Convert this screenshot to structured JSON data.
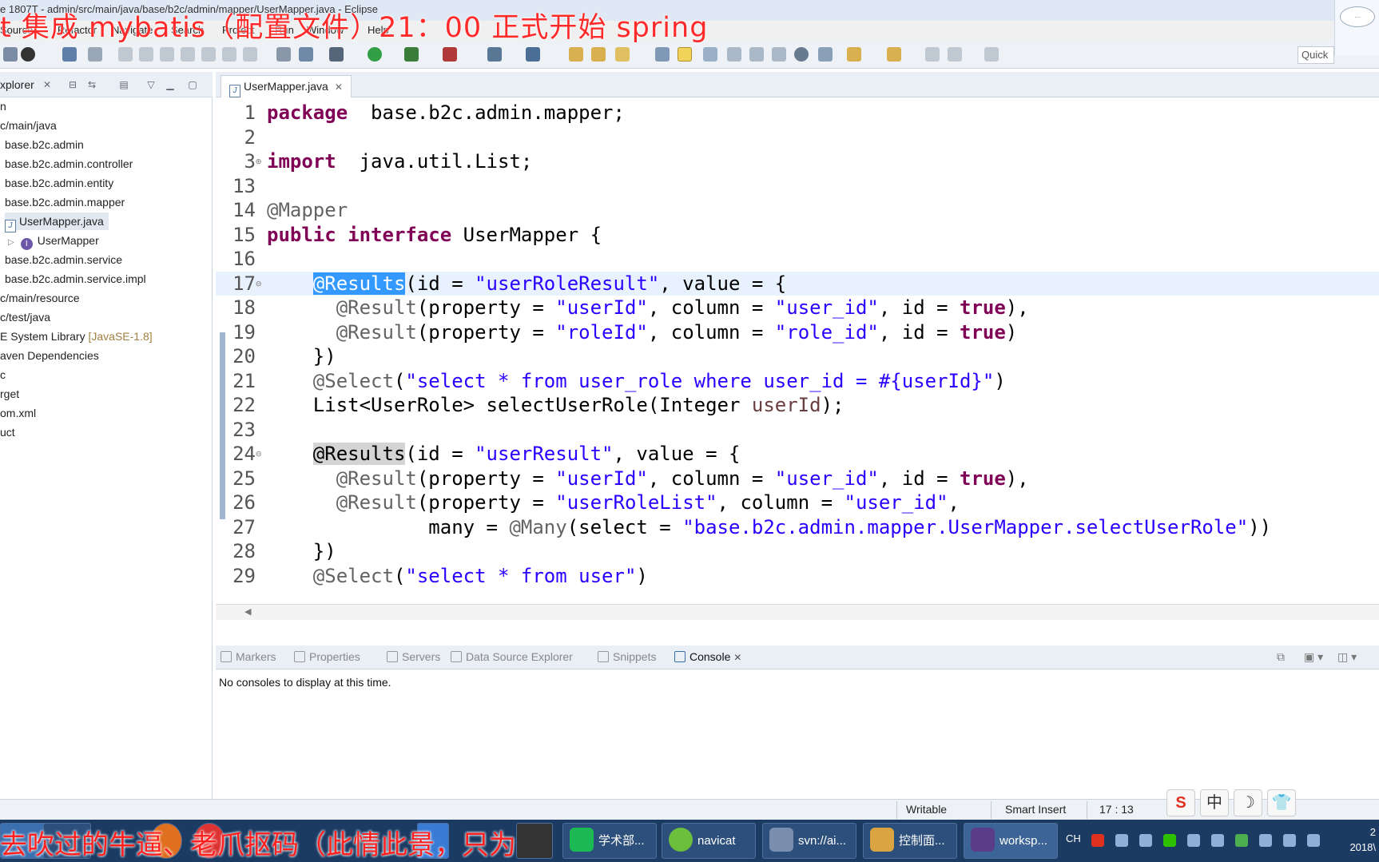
{
  "window": {
    "title_path": "e 1807T - admin/src/main/java/base/b2c/admin/mapper/UserMapper.java - Eclipse",
    "overlay_banner": "t 集成 mybatis（配置文件）21：00 正式开始  spring"
  },
  "menu": [
    "Source",
    "Refactor",
    "Navigate",
    "Search",
    "Project",
    "Run",
    "Window",
    "Help"
  ],
  "toolbar": {
    "quick_access": "Quick"
  },
  "explorer": {
    "title": "xplorer",
    "items": [
      {
        "label": "n"
      },
      {
        "label": "c/main/java"
      },
      {
        "label": "base.b2c.admin"
      },
      {
        "label": "base.b2c.admin.controller"
      },
      {
        "label": "base.b2c.admin.entity"
      },
      {
        "label": "base.b2c.admin.mapper"
      },
      {
        "label": "UserMapper.java"
      },
      {
        "label": "UserMapper"
      },
      {
        "label": "base.b2c.admin.service"
      },
      {
        "label": "base.b2c.admin.service.impl"
      },
      {
        "label": "c/main/resource"
      },
      {
        "label": "c/test/java"
      },
      {
        "label": "E System Library",
        "decoration": "[JavaSE-1.8]"
      },
      {
        "label": "aven Dependencies"
      },
      {
        "label": "c"
      },
      {
        "label": "rget"
      },
      {
        "label": "om.xml"
      },
      {
        "label": "uct"
      }
    ]
  },
  "editor": {
    "tab_label": "UserMapper.java",
    "lines": [
      {
        "n": "1",
        "segs": [
          [
            "kw",
            "package"
          ],
          [
            "",
            "  base.b2c.admin.mapper;"
          ]
        ]
      },
      {
        "n": "2",
        "segs": []
      },
      {
        "n": "3",
        "fold": "⊕",
        "segs": [
          [
            "kw",
            "import"
          ],
          [
            "",
            "  java.util.List;"
          ]
        ]
      },
      {
        "n": "13",
        "segs": []
      },
      {
        "n": "14",
        "segs": [
          [
            "ann",
            "@Mapper"
          ]
        ]
      },
      {
        "n": "15",
        "segs": [
          [
            "kw",
            "public"
          ],
          [
            "",
            " "
          ],
          [
            "kw",
            "interface"
          ],
          [
            "",
            "",
            " "
          ],
          [
            "",
            "UserMapper {"
          ]
        ]
      },
      {
        "n": "16",
        "segs": []
      },
      {
        "n": "17",
        "fold": "⊖",
        "cur": true,
        "segs": [
          [
            "",
            "    "
          ],
          [
            "ann-sel",
            "@Results"
          ],
          [
            "",
            "(id = "
          ],
          [
            "str",
            "\"userRoleResult\""
          ],
          [
            "",
            ", value = {"
          ]
        ]
      },
      {
        "n": "18",
        "segs": [
          [
            "",
            "      "
          ],
          [
            "ann",
            "@Result"
          ],
          [
            "",
            "(property = "
          ],
          [
            "str",
            "\"userId\""
          ],
          [
            "",
            ", column = "
          ],
          [
            "str",
            "\"user_id\""
          ],
          [
            "",
            ", id = "
          ],
          [
            "kw",
            "true"
          ],
          [
            "",
            "),"
          ]
        ]
      },
      {
        "n": "19",
        "segs": [
          [
            "",
            "      "
          ],
          [
            "ann",
            "@Result"
          ],
          [
            "",
            "(property = "
          ],
          [
            "str",
            "\"roleId\""
          ],
          [
            "",
            ", column = "
          ],
          [
            "str",
            "\"role_id\""
          ],
          [
            "",
            ", id = "
          ],
          [
            "kw",
            "true"
          ],
          [
            "",
            ")"
          ]
        ]
      },
      {
        "n": "20",
        "segs": [
          [
            "",
            "    })"
          ]
        ]
      },
      {
        "n": "21",
        "segs": [
          [
            "",
            "    "
          ],
          [
            "ann",
            "@Select"
          ],
          [
            "",
            "("
          ],
          [
            "str",
            "\"select * from user_role where user_id = #{userId}\""
          ],
          [
            "",
            ")"
          ]
        ]
      },
      {
        "n": "22",
        "segs": [
          [
            "",
            "    List<UserRole> selectUserRole(Integer "
          ],
          [
            "var",
            "userId"
          ],
          [
            "",
            ");"
          ]
        ]
      },
      {
        "n": "23",
        "segs": []
      },
      {
        "n": "24",
        "fold": "⊖",
        "segs": [
          [
            "",
            "    "
          ],
          [
            "ann-hl",
            "@Results"
          ],
          [
            "",
            "(id = "
          ],
          [
            "str",
            "\"userResult\""
          ],
          [
            "",
            ", value = {"
          ]
        ]
      },
      {
        "n": "25",
        "segs": [
          [
            "",
            "      "
          ],
          [
            "ann",
            "@Result"
          ],
          [
            "",
            "(property = "
          ],
          [
            "str",
            "\"userId\""
          ],
          [
            "",
            ", column = "
          ],
          [
            "str",
            "\"user_id\""
          ],
          [
            "",
            ", id = "
          ],
          [
            "kw",
            "true"
          ],
          [
            "",
            "),"
          ]
        ]
      },
      {
        "n": "26",
        "segs": [
          [
            "",
            "      "
          ],
          [
            "ann",
            "@Result"
          ],
          [
            "",
            "(property = "
          ],
          [
            "str",
            "\"userRoleList\""
          ],
          [
            "",
            ", column = "
          ],
          [
            "str",
            "\"user_id\""
          ],
          [
            "",
            ","
          ]
        ]
      },
      {
        "n": "27",
        "segs": [
          [
            "",
            "              many = "
          ],
          [
            "ann",
            "@Many"
          ],
          [
            "",
            "(select = "
          ],
          [
            "str",
            "\"base.b2c.admin.mapper.UserMapper.selectUserRole\""
          ],
          [
            "",
            "))"
          ]
        ]
      },
      {
        "n": "28",
        "segs": [
          [
            "",
            "    })"
          ]
        ]
      },
      {
        "n": "29",
        "segs": [
          [
            "",
            "    "
          ],
          [
            "ann",
            "@Select"
          ],
          [
            "",
            "("
          ],
          [
            "str",
            "\"select * from user\""
          ],
          [
            "",
            ")"
          ]
        ]
      }
    ]
  },
  "console": {
    "tabs": [
      "Markers",
      "Properties",
      "Servers",
      "Data Source Explorer",
      "Snippets",
      "Console"
    ],
    "message": "No consoles to display at this time."
  },
  "status": {
    "writable": "Writable",
    "insert_mode": "Smart Insert",
    "position": "17 : 13"
  },
  "ime": [
    "S",
    "中",
    "☽",
    "👕"
  ],
  "taskbar": {
    "sub_banner": "去吹过的牛逼、老爪抠码（此情此景，只为",
    "tasks": [
      {
        "label": "学术部...",
        "color": "#1db954"
      },
      {
        "label": "navicat",
        "color": "#6cbf3c"
      },
      {
        "label": "svn://ai...",
        "color": "#7a8fb0"
      },
      {
        "label": "控制面...",
        "color": "#d9a441"
      },
      {
        "label": "worksp...",
        "color": "#5a3d8a"
      }
    ],
    "lang": "CH",
    "clock": "2\n2018\\"
  }
}
